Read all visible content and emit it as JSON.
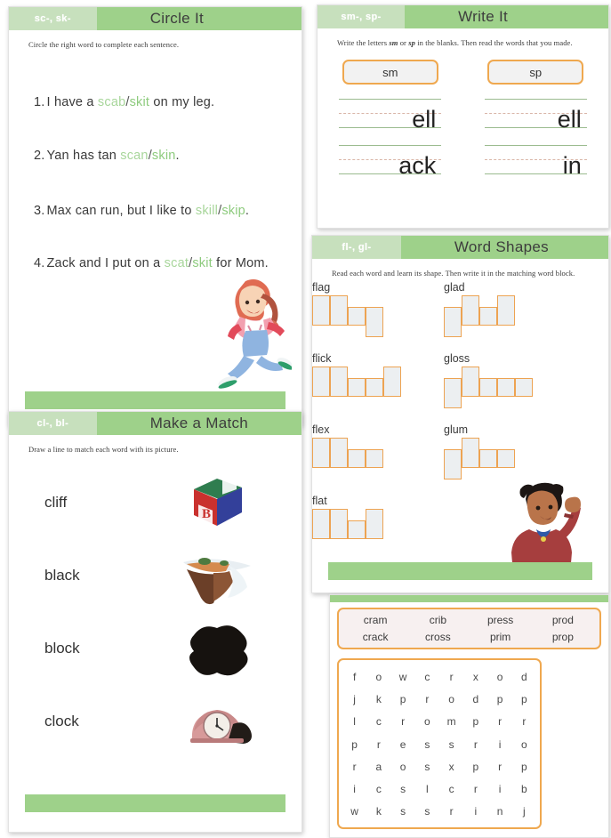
{
  "page": {
    "background": "#ffffff",
    "accent_green": "#9ed18a",
    "accent_green_light": "#c7e0bd",
    "accent_orange": "#efa84f",
    "word_green_1": "#a8d69b",
    "word_green_2": "#8ecb7e"
  },
  "circle_it": {
    "tab": "sc-, sk-",
    "title": "Circle It",
    "instruction": "Circle the right word to complete each sentence.",
    "sentences": [
      {
        "num": "1.",
        "pre": "I have a ",
        "opt1": "scab",
        "slash": "/",
        "opt2": "skit",
        "post": " on my leg."
      },
      {
        "num": "2.",
        "pre": "Yan has tan ",
        "opt1": "scan",
        "slash": "/",
        "opt2": "skin",
        "post": "."
      },
      {
        "num": "3.",
        "pre": "Max can run, but I like to ",
        "opt1": "skill",
        "slash": "/",
        "opt2": "skip",
        "post": "."
      },
      {
        "num": "4.",
        "pre": "Zack and I put on a ",
        "opt1": "scat",
        "slash": "/",
        "opt2": "skit",
        "post": " for Mom."
      }
    ],
    "illustration": "running-girl"
  },
  "write_it": {
    "tab": "sm-, sp-",
    "title": "Write It",
    "instruction_parts": [
      "Write the letters ",
      "sm",
      " or ",
      "sp",
      " in the blanks. Then read the words that you made."
    ],
    "chips": [
      "sm",
      "sp"
    ],
    "blanks": [
      {
        "left": "ell",
        "right": "ell"
      },
      {
        "left": "ack",
        "right": "in"
      }
    ]
  },
  "word_shapes": {
    "tab": "fl-, gl-",
    "title": "Word Shapes",
    "instruction": "Read each word and learn its shape. Then write it in the matching word block.",
    "words": [
      {
        "label": "flag",
        "shape": [
          "tall",
          "tall",
          "short",
          "desc"
        ]
      },
      {
        "label": "glad",
        "shape": [
          "desc",
          "tall",
          "short",
          "tall"
        ]
      },
      {
        "label": "flick",
        "shape": [
          "tall",
          "tall",
          "short",
          "short",
          "tall"
        ]
      },
      {
        "label": "gloss",
        "shape": [
          "desc",
          "tall",
          "short",
          "short",
          "short"
        ]
      },
      {
        "label": "flex",
        "shape": [
          "tall",
          "tall",
          "short",
          "short"
        ]
      },
      {
        "label": "glum",
        "shape": [
          "desc",
          "tall",
          "short",
          "short"
        ]
      },
      {
        "label": "flat",
        "shape": [
          "tall",
          "tall",
          "short",
          "tall"
        ]
      }
    ],
    "illustration": "boy-waving"
  },
  "make_a_match": {
    "tab": "cl-, bl-",
    "title": "Make a Match",
    "instruction": "Draw a line to match each word with its picture.",
    "rows": [
      {
        "word": "cliff",
        "picture": "alphabet-block"
      },
      {
        "word": "black",
        "picture": "cliff-ledge"
      },
      {
        "word": "block",
        "picture": "black-blob"
      },
      {
        "word": "clock",
        "picture": "mantel-clock"
      }
    ]
  },
  "word_search": {
    "word_bank": [
      "cram",
      "crib",
      "press",
      "prod",
      "crack",
      "cross",
      "prim",
      "prop"
    ],
    "grid": [
      [
        "f",
        "o",
        "w",
        "c",
        "r",
        "x",
        "o",
        "d"
      ],
      [
        "j",
        "k",
        "p",
        "r",
        "o",
        "d",
        "p",
        "p"
      ],
      [
        "l",
        "c",
        "r",
        "o",
        "m",
        "p",
        "r",
        "r"
      ],
      [
        "p",
        "r",
        "e",
        "s",
        "s",
        "r",
        "i",
        "o"
      ],
      [
        "r",
        "a",
        "o",
        "s",
        "x",
        "p",
        "r",
        "p"
      ],
      [
        "i",
        "c",
        "s",
        "l",
        "c",
        "r",
        "i",
        "b"
      ],
      [
        "w",
        "k",
        "s",
        "s",
        "r",
        "i",
        "n",
        "j"
      ]
    ]
  }
}
